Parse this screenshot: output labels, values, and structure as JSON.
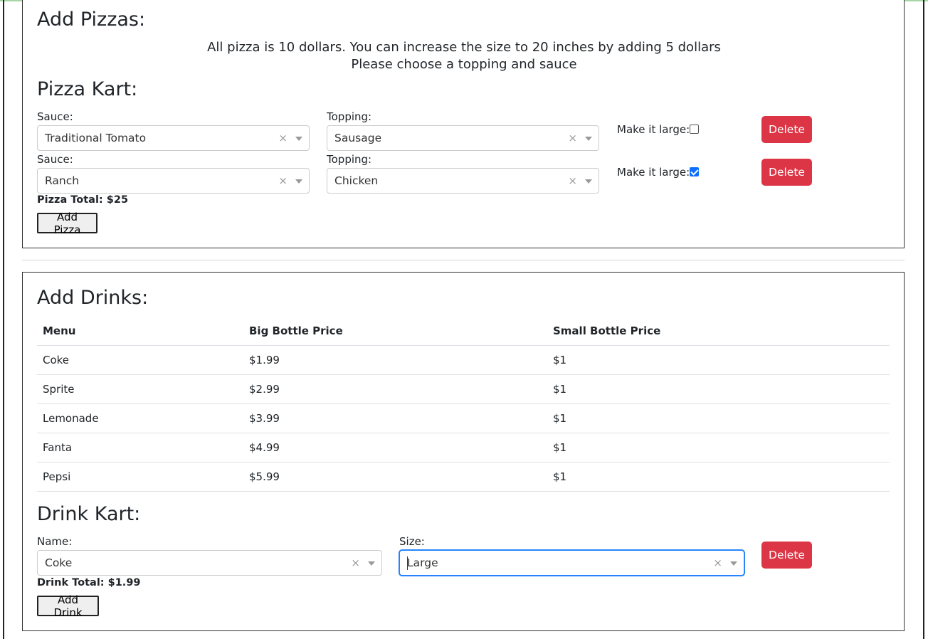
{
  "pizza": {
    "title": "Add Pizzas:",
    "notice_line1": "All pizza is 10 dollars. You can increase the size to 20 inches by adding 5 dollars",
    "notice_line2": "Please choose a topping and sauce",
    "kart_title": "Pizza Kart:",
    "items": [
      {
        "sauce_label": "Sauce:",
        "sauce": "Traditional Tomato",
        "topping_label": "Topping:",
        "topping": "Sausage",
        "large_label": "Make it large:",
        "large": false,
        "delete_label": "Delete"
      },
      {
        "sauce_label": "Sauce:",
        "sauce": "Ranch",
        "topping_label": "Topping:",
        "topping": "Chicken",
        "large_label": "Make it large:",
        "large": true,
        "delete_label": "Delete"
      }
    ],
    "total": "Pizza Total: $25",
    "add_label": "Add Pizza"
  },
  "drinks": {
    "title": "Add Drinks:",
    "table": {
      "headers": [
        "Menu",
        "Big Bottle Price",
        "Small Bottle Price"
      ],
      "rows": [
        [
          "Coke",
          "$1.99",
          "$1"
        ],
        [
          "Sprite",
          "$2.99",
          "$1"
        ],
        [
          "Lemonade",
          "$3.99",
          "$1"
        ],
        [
          "Fanta",
          "$4.99",
          "$1"
        ],
        [
          "Pepsi",
          "$5.99",
          "$1"
        ]
      ]
    },
    "kart_title": "Drink Kart:",
    "items": [
      {
        "name_label": "Name:",
        "name": "Coke",
        "size_label": "Size:",
        "size": "Large",
        "delete_label": "Delete"
      }
    ],
    "total": "Drink Total: $1.99",
    "add_label": "Add Drink"
  },
  "icons": {
    "clear": "clear-x-icon",
    "dropdown": "chevron-down-icon",
    "clear_glyph": "×"
  },
  "colors": {
    "danger": "#dc3545",
    "focus": "#2684ff",
    "checkbox_checked": "#0d6efd"
  }
}
